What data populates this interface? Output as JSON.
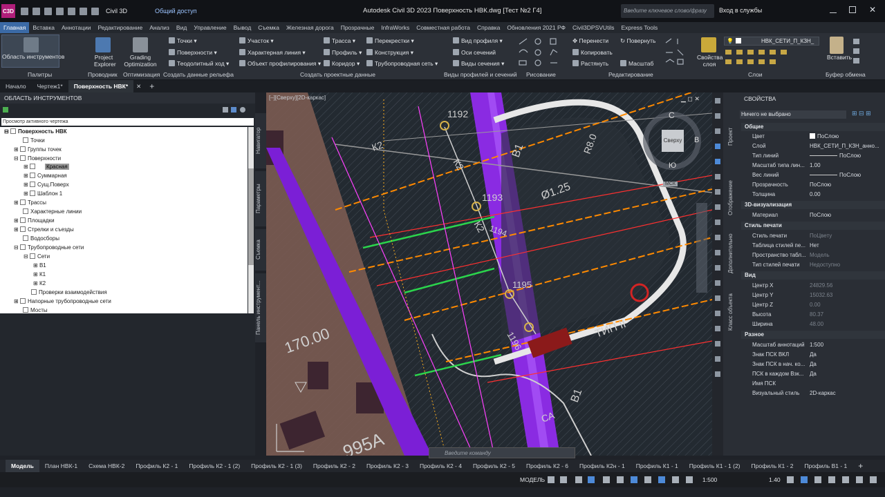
{
  "app": {
    "logo": "C3D",
    "workspace": "Civil 3D",
    "shared_view": "Общий доступ",
    "title": "Autodesk Civil 3D 2023   Поверхность НВК.dwg [Тест №2 Г4]",
    "search_placeholder": "Введите ключевое слово/фразу",
    "login": "Вход в службы"
  },
  "menu": [
    "Главная",
    "Вставка",
    "Аннотации",
    "Редактирование",
    "Анализ",
    "Вид",
    "Управление",
    "Вывод",
    "Съемка",
    "Железная дорога",
    "Прозрачные",
    "InfraWorks",
    "Совместная работа",
    "Справка",
    "Обновления 2021 РФ",
    "Civil3DPSVUtils",
    "Express Tools"
  ],
  "ribbon": {
    "toolspace": "Область инструментов",
    "project_explorer": "Project Explorer",
    "grading": "Grading Optimization",
    "points": "Точки",
    "surfaces": "Поверхности",
    "traverse": "Теодолитный ход",
    "parcel": "Участок",
    "feature_line": "Характерная линия",
    "profile_object": "Объект профилирования",
    "alignment": "Трасса",
    "profile": "Профиль",
    "corridor": "Коридор",
    "intersections": "Перекрестки",
    "assembly": "Конструкция",
    "pipe_network": "Трубопроводная сеть",
    "profile_view": "Вид профиля",
    "sample_lines": "Оси сечений",
    "section_views": "Виды сечения",
    "move": "Перенести",
    "copy": "Копировать",
    "stretch": "Растянуть",
    "rotate": "Повернуть",
    "scale": "Масштаб",
    "layer_name": "НВК_СЕТИ_П_КЗН_",
    "layer_props": "Свойства слоя",
    "paste": "Вставить",
    "panels": {
      "palettes": "Палитры",
      "explorer": "Проводник",
      "optimization": "Оптимизация",
      "ground": "Создать данные рельефа",
      "design": "Создать проектные данные",
      "views": "Виды профилей и сечений",
      "draw": "Рисование",
      "modify": "Редактирование",
      "layers": "Слои",
      "clipboard": "Буфер обмена"
    }
  },
  "file_tabs": [
    "Начало",
    "Чертеж1*",
    "Поверхность НВК*"
  ],
  "toolspace": {
    "header": "ОБЛАСТЬ ИНСТРУМЕНТОВ",
    "view": "Просмотр активного чертежа",
    "tree": [
      "Поверхность НВК",
      "Точки",
      "Группы точек",
      "Поверхности",
      "Красная",
      "Суммарная",
      "Сущ.Поверх",
      "Шаблон 1",
      "Трассы",
      "Характерные линии",
      "Площадки",
      "Стрелки и съезды",
      "Водосборы",
      "Трубопроводные сети",
      "Сети",
      "В1",
      "К1",
      "К2",
      "Проверки взаимодействия",
      "Напорные трубопроводные сети",
      "Мосты"
    ]
  },
  "side_tabs": [
    "Навигатор",
    "Параметры",
    "Съемка",
    "Панель инструмент..."
  ],
  "viewport": {
    "label": "[–][Сверху][2D-каркас]",
    "viewcube": "Сверху",
    "c": "С",
    "w": "В",
    "s": "Ю",
    "wcs": "МСК",
    "texts": {
      "t1192": "1192",
      "t1193": "1193",
      "t1194": "1194",
      "t1195": "1195",
      "t1196": "1196",
      "k2a": "К2",
      "k2b": "К2",
      "k2c": "К2",
      "w1": "В1",
      "w1b": "В1",
      "r": "R8.0",
      "d": "Ø1.25",
      "tip": "ТИП II",
      "elev": "170.00",
      "bld": "995А",
      "ca": "СА"
    }
  },
  "command_placeholder": "Введите команду",
  "props": {
    "header": "СВОЙСТВА",
    "selection": "Ничего не выбрано",
    "vtabs": [
      "Проект",
      "Отображение",
      "Дополнительно",
      "Класс объекта"
    ],
    "sections": [
      "Общие",
      "3D-визуализация",
      "Стиль печати",
      "Вид",
      "Разное"
    ],
    "rows": [
      [
        "Цвет",
        "ПоСлою"
      ],
      [
        "Слой",
        "НВК_СЕТИ_П_КЗН_анно..."
      ],
      [
        "Тип линий",
        "ПоСлою"
      ],
      [
        "Масштаб типа лин...",
        "1.00"
      ],
      [
        "Вес линий",
        "ПоСлою"
      ],
      [
        "Прозрачность",
        "ПоСлою"
      ],
      [
        "Толщина",
        "0.00"
      ],
      [
        "Материал",
        "ПоСлою"
      ],
      [
        "Стиль печати",
        "ПоЦвету"
      ],
      [
        "Таблица стилей пе...",
        "Нет"
      ],
      [
        "Пространство табл...",
        "Модель"
      ],
      [
        "Тип стилей печати",
        "Недоступно"
      ],
      [
        "Центр X",
        "24829.56"
      ],
      [
        "Центр Y",
        "15032.63"
      ],
      [
        "Центр Z",
        "0.00"
      ],
      [
        "Высота",
        "80.37"
      ],
      [
        "Ширина",
        "48.00"
      ],
      [
        "Масштаб аннотаций",
        "1:500"
      ],
      [
        "Знак ПСК ВКЛ",
        "Да"
      ],
      [
        "Знак ПСК в нач. ко...",
        "Да"
      ],
      [
        "ПСК в каждом Взк...",
        "Да"
      ],
      [
        "Имя ПСК",
        ""
      ],
      [
        "Визуальный стиль",
        "2D-каркас"
      ]
    ]
  },
  "layouts": [
    "Модель",
    "План НВК-1",
    "Схема НВК-2",
    "Профиль К2 - 1",
    "Профиль К2 - 1 (2)",
    "Профиль К2 - 1 (3)",
    "Профиль К2 - 2",
    "Профиль К2 - 3",
    "Профиль К2 - 4",
    "Профиль К2 - 5",
    "Профиль К2 - 6",
    "Профиль К2н - 1",
    "Профиль К1 - 1",
    "Профиль К1 - 1 (2)",
    "Профиль К1 - 2",
    "Профиль В1 - 1"
  ],
  "status": {
    "model": "МОДЕЛЬ",
    "scale": "1:500",
    "lw": "1.40"
  }
}
